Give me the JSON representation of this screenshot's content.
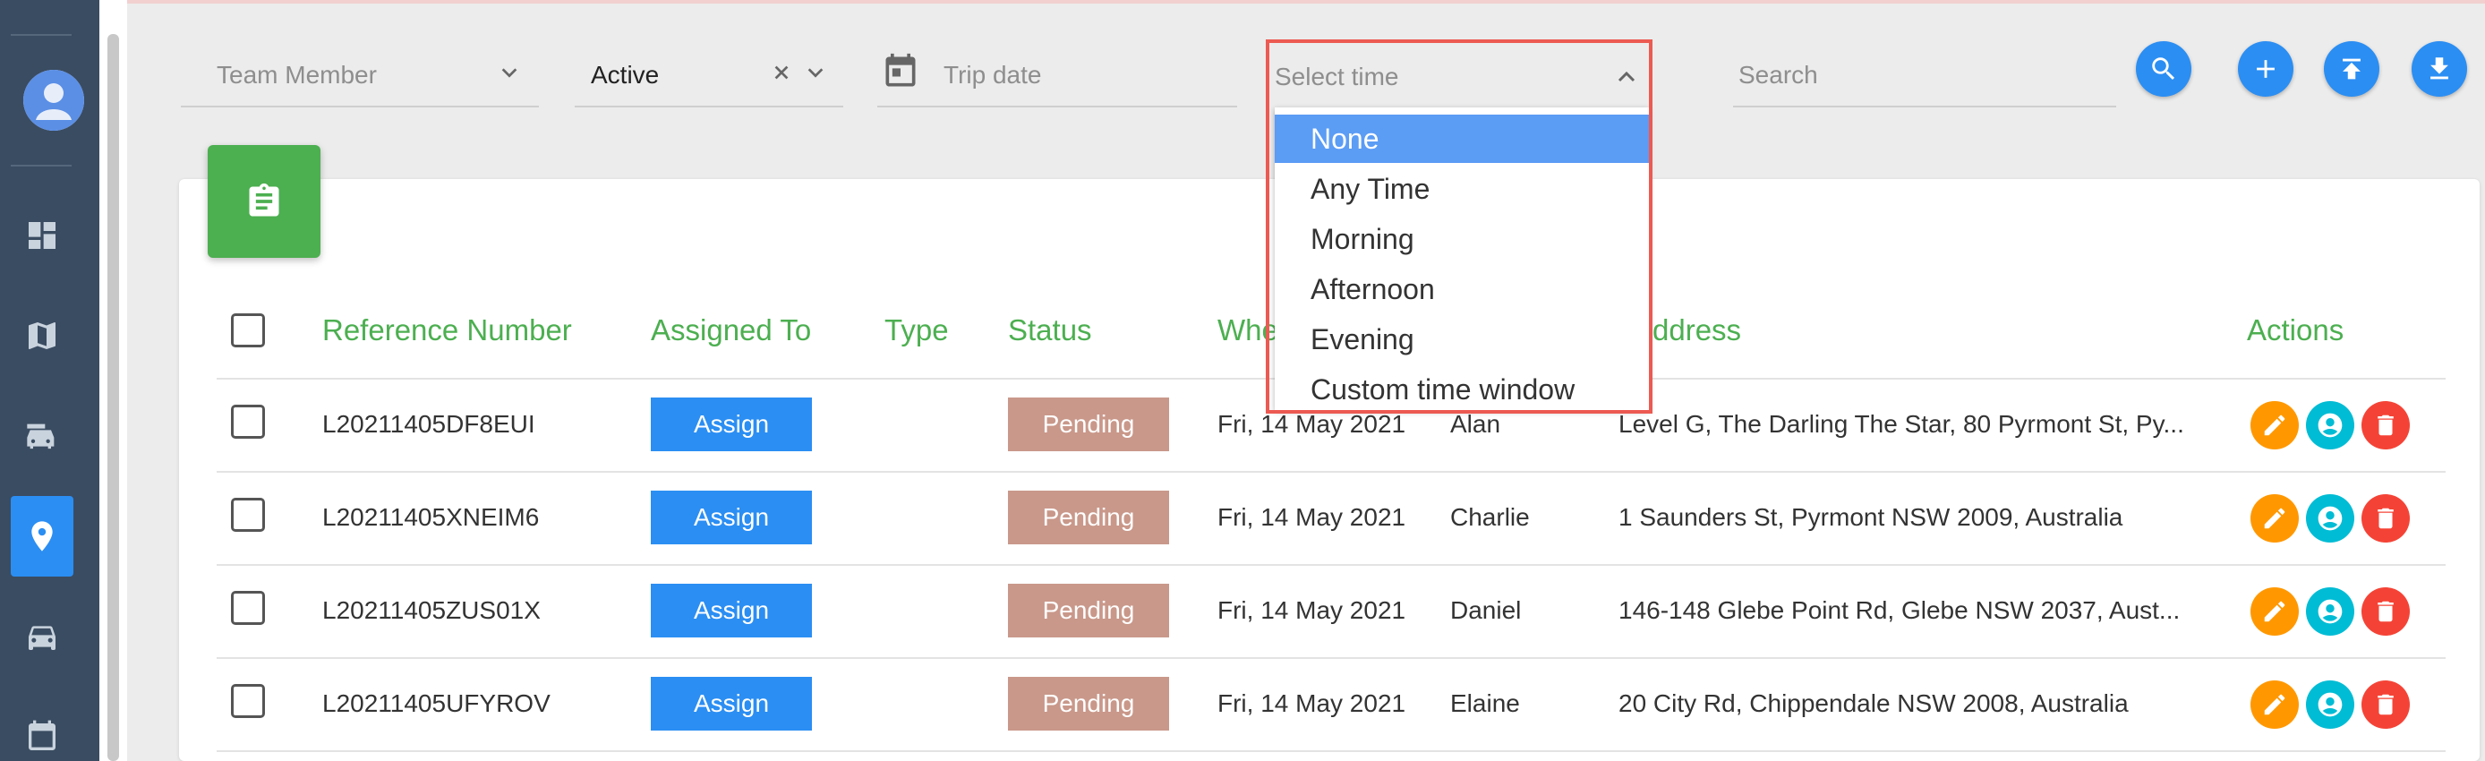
{
  "filters": {
    "team_member_placeholder": "Team Member",
    "status_value": "Active",
    "trip_date_placeholder": "Trip date",
    "select_time_placeholder": "Select time",
    "search_placeholder": "Search"
  },
  "time_dropdown": {
    "options": [
      "None",
      "Any Time",
      "Morning",
      "Afternoon",
      "Evening",
      "Custom time window"
    ],
    "selected": "None"
  },
  "table": {
    "headers": {
      "reference": "Reference Number",
      "assigned": "Assigned To",
      "type": "Type",
      "status": "Status",
      "when": "Whe",
      "address": "ddress",
      "actions": "Actions"
    },
    "rows": [
      {
        "ref": "L20211405DF8EUI",
        "assign": "Assign",
        "status": "Pending",
        "date": "Fri, 14 May 2021",
        "name": "Alan",
        "address": "Level G, The Darling The Star, 80 Pyrmont St, Py..."
      },
      {
        "ref": "L20211405XNEIM6",
        "assign": "Assign",
        "status": "Pending",
        "date": "Fri, 14 May 2021",
        "name": "Charlie",
        "address": "1 Saunders St, Pyrmont NSW 2009, Australia"
      },
      {
        "ref": "L20211405ZUS01X",
        "assign": "Assign",
        "status": "Pending",
        "date": "Fri, 14 May 2021",
        "name": "Daniel",
        "address": "146-148 Glebe Point Rd, Glebe NSW 2037, Aust..."
      },
      {
        "ref": "L20211405UFYROV",
        "assign": "Assign",
        "status": "Pending",
        "date": "Fri, 14 May 2021",
        "name": "Elaine",
        "address": "20 City Rd, Chippendale NSW 2008, Australia"
      }
    ]
  },
  "colors": {
    "primary": "#2b8ef3",
    "green": "#4caf50",
    "pending": "#c9988a",
    "edit": "#ff9800",
    "view": "#00bcd4",
    "delete": "#f44336",
    "highlight": "#ec5a52"
  },
  "icons": [
    "avatar-icon",
    "dashboard-icon",
    "map-icon",
    "fleet-icon",
    "location-pin-icon",
    "car-icon",
    "calendar-icon",
    "search-icon",
    "add-icon",
    "upload-icon",
    "download-icon",
    "clipboard-icon",
    "pencil-icon",
    "user-circle-icon",
    "trash-icon"
  ]
}
